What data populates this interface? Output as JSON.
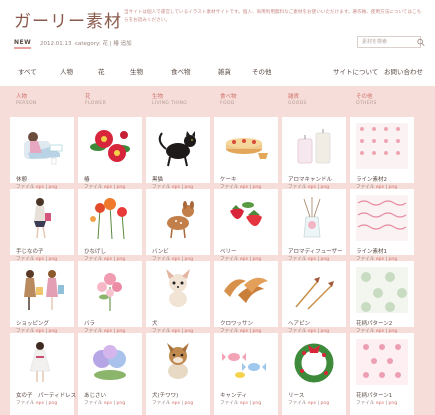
{
  "site": {
    "logo": "ガーリー素材",
    "intro": "当サイトは個人で運営しているイラスト素材サイトです。個人、商用利用無料なご素材をお使いいただけます。著作権、使用方法についてはこちらをお読みください。"
  },
  "news": {
    "badge": "NEW",
    "date": "2012.01.13",
    "category_label": "category",
    "category_value": "花",
    "separator": "|",
    "item": "椿 追加"
  },
  "search": {
    "placeholder": "素材を検索"
  },
  "nav": {
    "items": [
      "すべて",
      "人物",
      "花",
      "生物",
      "食べ物",
      "雑貨",
      "その他"
    ],
    "about": "サイトについて",
    "contact": "お問い合わせ"
  },
  "categories": [
    {
      "jp": "人物",
      "en": "PERSON"
    },
    {
      "jp": "花",
      "en": "FLOWER"
    },
    {
      "jp": "生物",
      "en": "LIVING THING"
    },
    {
      "jp": "食べ物",
      "en": "FOOD"
    },
    {
      "jp": "雑貨",
      "en": "GOODS"
    },
    {
      "jp": "その他",
      "en": "OTHERS"
    }
  ],
  "format": {
    "label": "ファイル",
    "eps": "eps",
    "png": "png"
  },
  "cards": [
    [
      {
        "name": "休憩",
        "icon": "woman-resting-icon"
      },
      {
        "name": "手じなの子",
        "icon": "girl-walking-icon"
      },
      {
        "name": "ショッピング",
        "icon": "shopping-girls-icon"
      },
      {
        "name": "女の子　パーティドレス",
        "icon": "party-dress-girl-icon"
      }
    ],
    [
      {
        "name": "椿",
        "icon": "camellia-icon"
      },
      {
        "name": "ひなげし",
        "icon": "poppy-icon"
      },
      {
        "name": "バラ",
        "icon": "rose-icon"
      },
      {
        "name": "あじさい",
        "icon": "hydrangea-icon"
      }
    ],
    [
      {
        "name": "黒猫",
        "icon": "black-cat-icon"
      },
      {
        "name": "バンビ",
        "icon": "bambi-icon"
      },
      {
        "name": "犬",
        "icon": "chihuahua-icon"
      },
      {
        "name": "犬(チワワ)",
        "icon": "puppy-icon"
      }
    ],
    [
      {
        "name": "ケーキ",
        "icon": "cake-icon"
      },
      {
        "name": "ベリー",
        "icon": "strawberry-icon"
      },
      {
        "name": "クロワッサン",
        "icon": "croissant-icon"
      },
      {
        "name": "キャンディ",
        "icon": "candy-icon"
      }
    ],
    [
      {
        "name": "アロマキャンドル",
        "icon": "aroma-candle-icon"
      },
      {
        "name": "アロマディフューザー",
        "icon": "aroma-diffuser-icon"
      },
      {
        "name": "ヘアピン",
        "icon": "hairpin-icon"
      },
      {
        "name": "リース",
        "icon": "wreath-icon"
      }
    ],
    [
      {
        "name": "ライン素材2",
        "icon": "line-pattern-icon"
      },
      {
        "name": "ライン素材1",
        "icon": "ribbon-line-icon"
      },
      {
        "name": "花柄パターン2",
        "icon": "floral-pattern-2-icon"
      },
      {
        "name": "花柄パターン1",
        "icon": "floral-pattern-1-icon"
      }
    ]
  ]
}
